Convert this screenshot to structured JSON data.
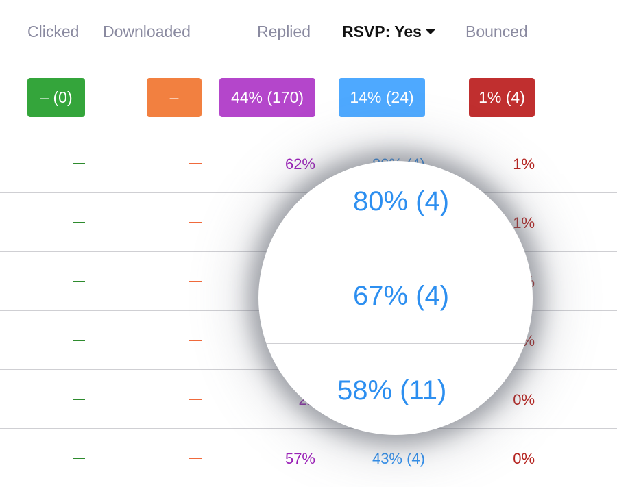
{
  "header": {
    "columns": [
      {
        "label": "Clicked",
        "active": false
      },
      {
        "label": "Downloaded",
        "active": false
      },
      {
        "label": "Replied",
        "active": false
      },
      {
        "label": "RSVP: Yes",
        "active": true,
        "icon": "caret-down-icon"
      },
      {
        "label": "Bounced",
        "active": false
      }
    ]
  },
  "totals": {
    "clicked": "– (0)",
    "downloaded": "–",
    "replied": "44% (170)",
    "rsvp": "14% (24)",
    "bounced": "1% (4)"
  },
  "colors": {
    "clicked": "#34a53b",
    "downloaded": "#f28040",
    "replied": "#b446cb",
    "rsvp": "#4ea9ff",
    "bounced": "#c02f2f",
    "clicked_text": "#2e8b2e",
    "downloaded_text": "#f06a3c",
    "replied_text": "#9b1fb8",
    "rsvp_text": "#2d8ff0",
    "bounced_text": "#b5231f",
    "header_text": "#8a8aa0"
  },
  "rows": [
    {
      "clicked": "–",
      "downloaded": "–",
      "replied": "62%",
      "rsvp": "80% (4)",
      "bounced": "1%"
    },
    {
      "clicked": "–",
      "downloaded": "–",
      "replied": "",
      "rsvp": "",
      "bounced": "1%"
    },
    {
      "clicked": "–",
      "downloaded": "–",
      "replied": "",
      "rsvp": "",
      "bounced": "%"
    },
    {
      "clicked": "–",
      "downloaded": "–",
      "replied": "",
      "rsvp": "",
      "bounced": "%"
    },
    {
      "clicked": "–",
      "downloaded": "–",
      "replied": "22",
      "rsvp": "",
      "bounced": "0%"
    },
    {
      "clicked": "–",
      "downloaded": "–",
      "replied": "57%",
      "rsvp": "43% (4)",
      "bounced": "0%"
    }
  ],
  "magnifier": {
    "values": [
      "80% (4)",
      "67% (4)",
      "58% (11)"
    ]
  }
}
